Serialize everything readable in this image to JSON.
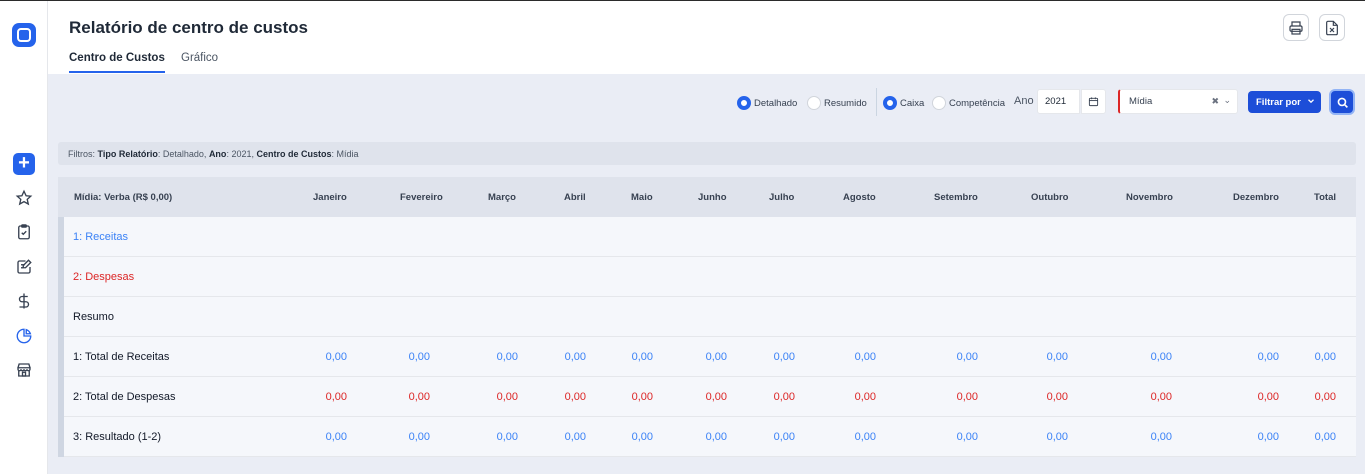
{
  "header": {
    "title": "Relatório de centro de custos",
    "tabs": [
      {
        "label": "Centro de Custos"
      },
      {
        "label": "Gráfico"
      }
    ]
  },
  "controls": {
    "mode_detalhado": "Detalhado",
    "mode_resumido": "Resumido",
    "regime_caixa": "Caixa",
    "regime_competencia": "Competência",
    "ano_label": "Ano",
    "ano_value": "2021",
    "cost_center_value": "Mídia",
    "filter_button": "Filtrar por"
  },
  "filters_bar": {
    "prefix": "Filtros:",
    "tipo_key": "Tipo Relatório",
    "tipo_val": "Detalhado,",
    "ano_key": "Ano",
    "ano_val": "2021,",
    "cc_key": "Centro de Custos",
    "cc_val": "Mídia"
  },
  "table": {
    "first_header": "Mídia: Verba (R$ 0,00)",
    "months": [
      "Janeiro",
      "Fevereiro",
      "Março",
      "Abril",
      "Maio",
      "Junho",
      "Julho",
      "Agosto",
      "Setembro",
      "Outubro",
      "Novembro",
      "Dezembro",
      "Total"
    ],
    "rows": [
      {
        "label": "1: Receitas",
        "values": []
      },
      {
        "label": "2: Despesas",
        "values": []
      },
      {
        "label": "Resumo",
        "values": []
      },
      {
        "label": "1: Total de Receitas",
        "values": [
          "0,00",
          "0,00",
          "0,00",
          "0,00",
          "0,00",
          "0,00",
          "0,00",
          "0,00",
          "0,00",
          "0,00",
          "0,00",
          "0,00",
          "0,00"
        ]
      },
      {
        "label": "2: Total de Despesas",
        "values": [
          "0,00",
          "0,00",
          "0,00",
          "0,00",
          "0,00",
          "0,00",
          "0,00",
          "0,00",
          "0,00",
          "0,00",
          "0,00",
          "0,00",
          "0,00"
        ]
      },
      {
        "label": "3: Resultado (1-2)",
        "values": [
          "0,00",
          "0,00",
          "0,00",
          "0,00",
          "0,00",
          "0,00",
          "0,00",
          "0,00",
          "0,00",
          "0,00",
          "0,00",
          "0,00",
          "0,00"
        ]
      }
    ]
  },
  "colors": {
    "accent": "#2563eb",
    "receita": "#3b82f6",
    "despesa": "#dc2626"
  }
}
